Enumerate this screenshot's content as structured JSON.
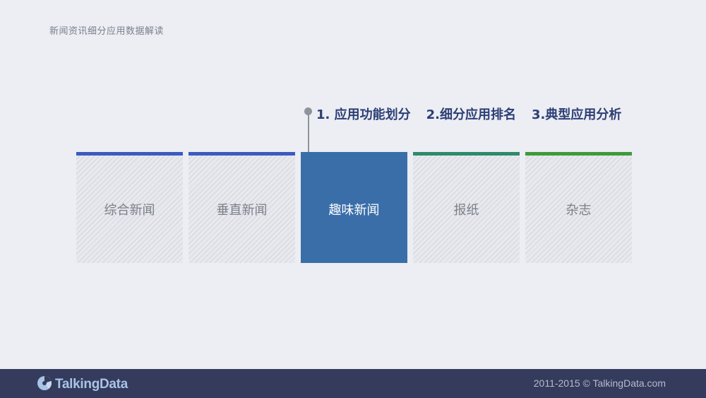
{
  "header": {
    "title": "新闻资讯细分应用数据解读"
  },
  "steps": [
    {
      "label": "1. 应用功能划分"
    },
    {
      "label": "2.细分应用排名"
    },
    {
      "label": "3.典型应用分析"
    }
  ],
  "categories": [
    {
      "label": "综合新闻",
      "bar_color": "#3a5bbf",
      "active": false
    },
    {
      "label": "垂直新闻",
      "bar_color": "#3a5bbf",
      "active": false
    },
    {
      "label": "趣味新闻",
      "bar_color": "#3a6ea9",
      "active": true
    },
    {
      "label": "报纸",
      "bar_color": "#2f8a6a",
      "active": false
    },
    {
      "label": "杂志",
      "bar_color": "#3f9a3a",
      "active": false
    }
  ],
  "footer": {
    "logo_text": "TalkingData",
    "logo_icon": "talkingdata-logo-icon",
    "copyright": "2011-2015 © TalkingData.com"
  },
  "colors": {
    "background": "#eceef3",
    "footer": "#343b5c",
    "step_text": "#2c3e75",
    "active_tile": "#3a6ea9"
  }
}
